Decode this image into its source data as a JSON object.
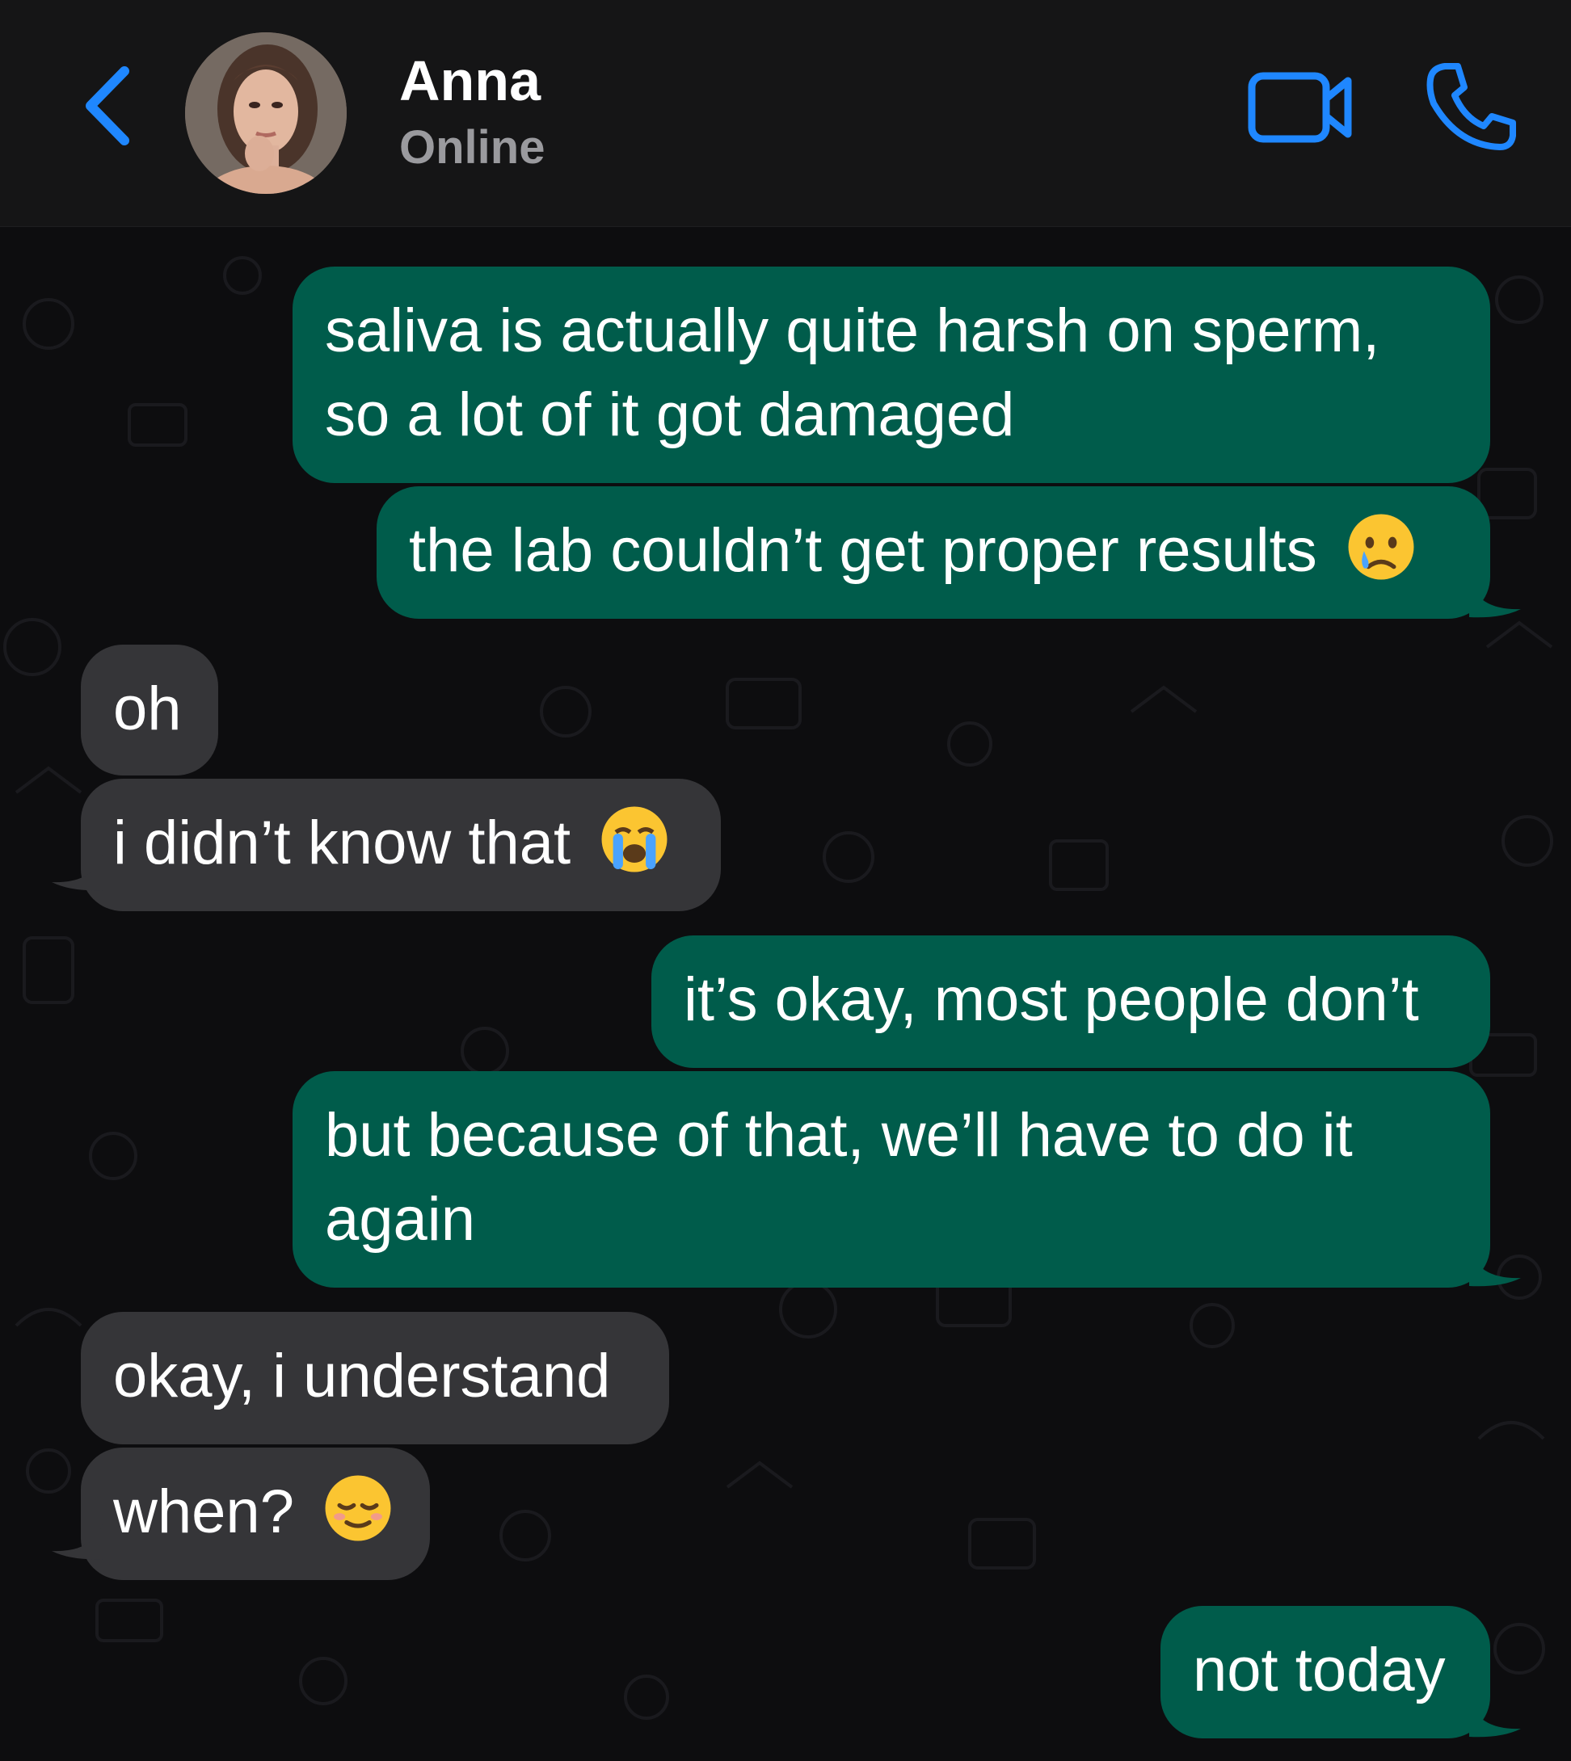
{
  "header": {
    "contact_name": "Anna",
    "status": "Online",
    "back_icon": "chevron-left-icon",
    "video_icon": "video-camera-icon",
    "call_icon": "phone-icon",
    "accent_color": "#1f87ff"
  },
  "messages": [
    {
      "direction": "outgoing",
      "text": "saliva is actually quite harsh on sperm, so a lot of it got damaged"
    },
    {
      "direction": "outgoing",
      "text": "the lab couldn’t get proper results",
      "emoji": "crying-face-emoji"
    },
    {
      "direction": "incoming",
      "text": "oh"
    },
    {
      "direction": "incoming",
      "text": "i didn’t know that",
      "emoji": "loudly-crying-face-emoji"
    },
    {
      "direction": "outgoing",
      "text": "it’s okay, most people don’t"
    },
    {
      "direction": "outgoing",
      "text": "but because of that, we’ll have to do it again"
    },
    {
      "direction": "incoming",
      "text": "okay, i understand"
    },
    {
      "direction": "incoming",
      "text": "when?",
      "emoji": "relieved-face-emoji"
    },
    {
      "direction": "outgoing",
      "text": "not today"
    }
  ],
  "colors": {
    "outgoing_bubble": "#005c4b",
    "incoming_bubble": "#353538",
    "header_bg": "#151516",
    "chat_bg": "#0d0d0f"
  }
}
